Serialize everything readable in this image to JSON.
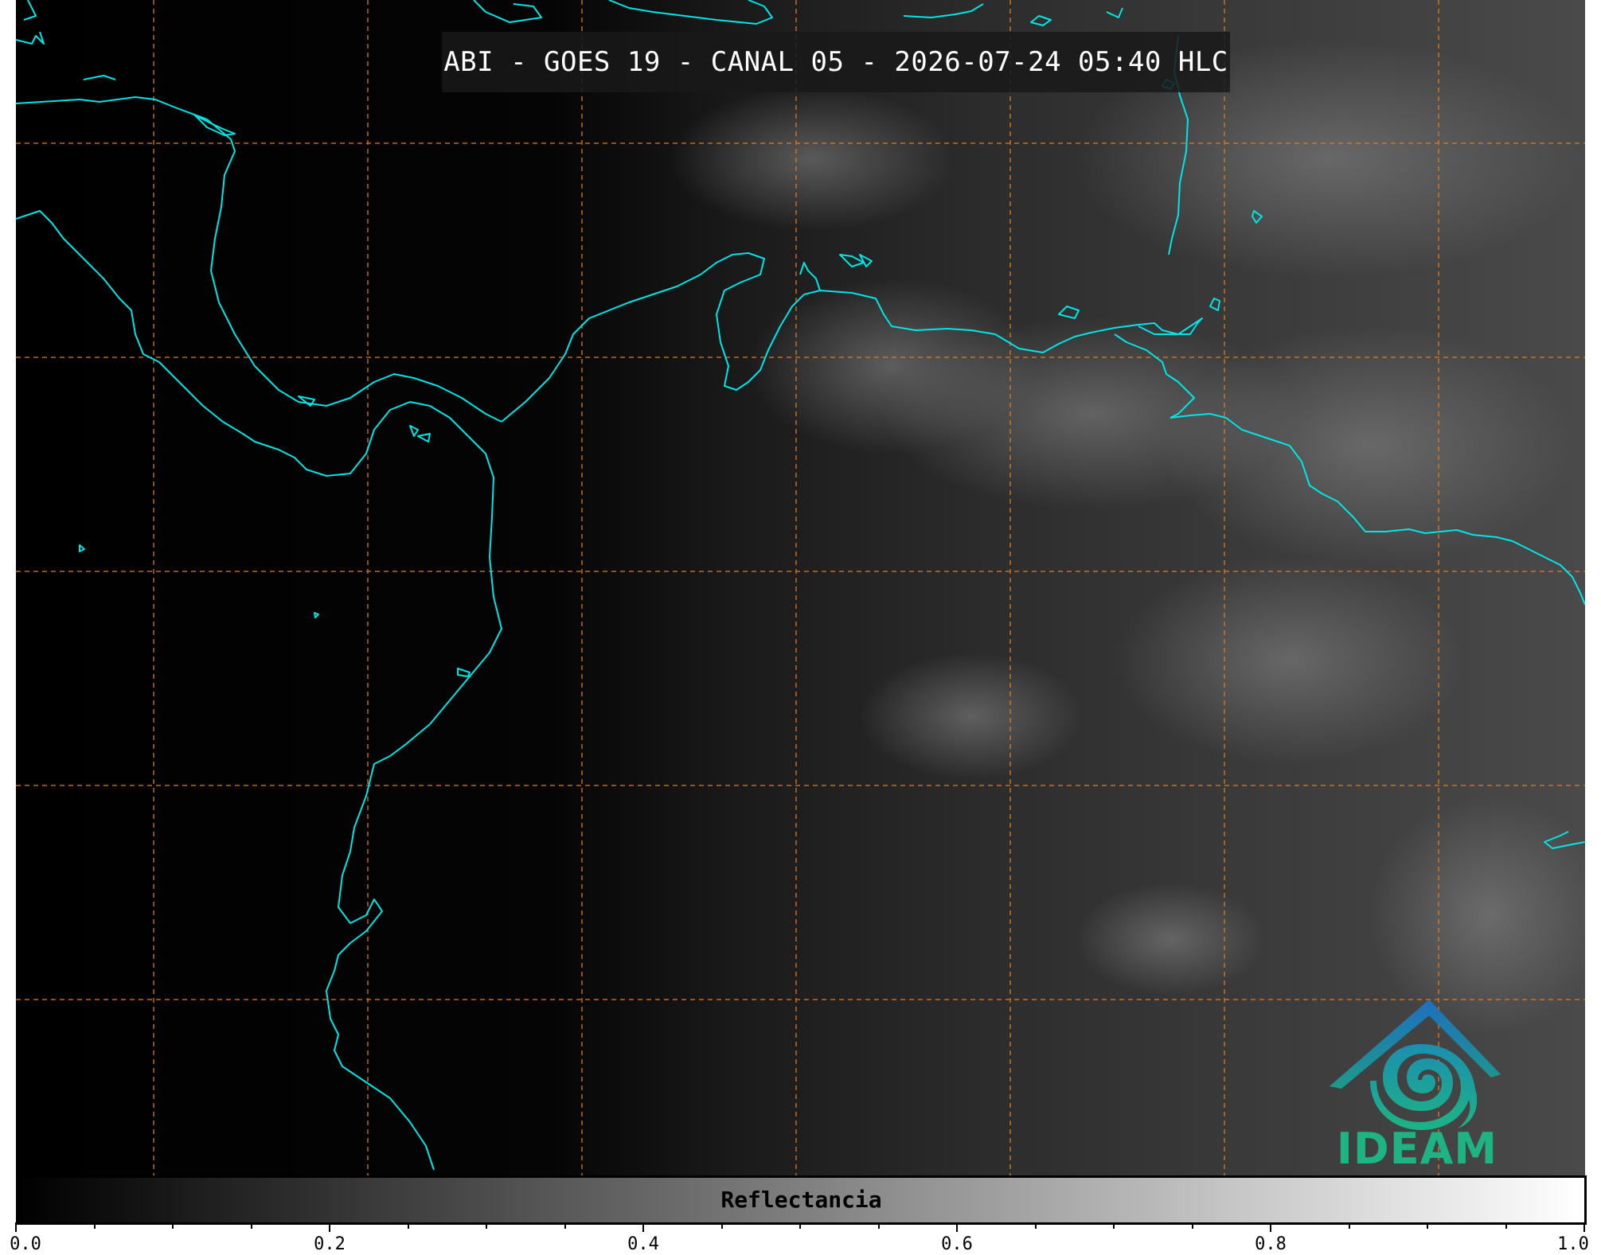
{
  "title": "ABI - GOES 19 - CANAL 05 - 2026-07-24 05:40 HLC",
  "colorbar": {
    "label": "Reflectancia",
    "ticks": [
      "0.0",
      "0.2",
      "0.4",
      "0.6",
      "0.8",
      "1.0"
    ],
    "range": [
      0.0,
      1.0
    ],
    "colormap": "gray"
  },
  "logo": {
    "text": "IDEAM",
    "icon": "ideam-logo-icon"
  },
  "colors": {
    "coastline": "#00e5e5",
    "gridlines": "#e07a20",
    "background": "#000000",
    "logo_green": "#1db383",
    "logo_blue": "#1f6fbf"
  }
}
